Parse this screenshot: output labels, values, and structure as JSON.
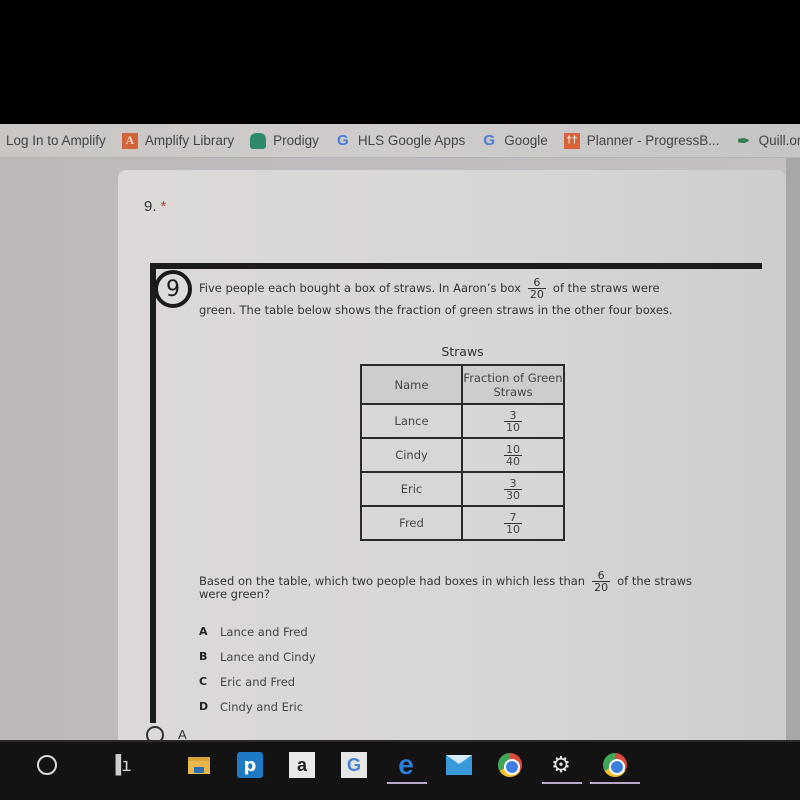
{
  "bookmarks": [
    {
      "label": "Log In to Amplify",
      "icon": "none"
    },
    {
      "label": "Amplify Library",
      "icon": "amplify-icon",
      "glyph": "A"
    },
    {
      "label": "Prodigy",
      "icon": "prodigy-icon",
      "glyph": ""
    },
    {
      "label": "HLS Google Apps",
      "icon": "google-icon",
      "glyph": "G"
    },
    {
      "label": "Google",
      "icon": "google-icon",
      "glyph": "G"
    },
    {
      "label": "Planner - ProgressB...",
      "icon": "planner-icon",
      "glyph": "††"
    },
    {
      "label": "Quill.org — Inte",
      "icon": "quill-icon",
      "glyph": "✒"
    }
  ],
  "question": {
    "number_label": "9.",
    "required_marker": "*",
    "badge_number": "9",
    "stem_line1_before": "Five people each bought a box of straws. In Aaron’s box",
    "aaron_fraction": {
      "num": "6",
      "den": "20"
    },
    "stem_line1_after": "of the straws were",
    "stem_line2": "green. The table below shows the fraction of green straws in the other four boxes.",
    "table": {
      "title": "Straws",
      "headers": [
        "Name",
        "Fraction of Green Straws"
      ],
      "rows": [
        {
          "name": "Lance",
          "num": "3",
          "den": "10"
        },
        {
          "name": "Cindy",
          "num": "10",
          "den": "40"
        },
        {
          "name": "Eric",
          "num": "3",
          "den": "30"
        },
        {
          "name": "Fred",
          "num": "7",
          "den": "10"
        }
      ]
    },
    "prompt_before": "Based on the table, which two people had boxes in which less than",
    "prompt_fraction": {
      "num": "6",
      "den": "20"
    },
    "prompt_after": "of the straws",
    "prompt_line2": "were green?",
    "options": [
      {
        "letter": "A",
        "text": "Lance and Fred"
      },
      {
        "letter": "B",
        "text": "Lance and Cindy"
      },
      {
        "letter": "C",
        "text": "Eric and Fred"
      },
      {
        "letter": "D",
        "text": "Cindy and Eric"
      }
    ],
    "answer_choices": [
      {
        "label": "A",
        "selected": false
      }
    ]
  },
  "taskbar": {
    "items": [
      {
        "name": "cortana-search",
        "icon": "circle-icon"
      },
      {
        "name": "task-view",
        "icon": "task-view-icon",
        "glyph": "▐ı"
      },
      {
        "name": "file-explorer",
        "icon": "folder-icon"
      },
      {
        "name": "pandora",
        "icon": "pandora-icon",
        "glyph": "p"
      },
      {
        "name": "amazon",
        "icon": "amazon-icon",
        "glyph": "a"
      },
      {
        "name": "google",
        "icon": "google-icon",
        "glyph": "G"
      },
      {
        "name": "edge",
        "icon": "edge-icon",
        "glyph": "e"
      },
      {
        "name": "mail",
        "icon": "mail-icon"
      },
      {
        "name": "chrome",
        "icon": "chrome-icon"
      },
      {
        "name": "settings",
        "icon": "gear-icon",
        "glyph": "⚙"
      },
      {
        "name": "chrome-profile",
        "icon": "chrome-icon"
      }
    ]
  }
}
